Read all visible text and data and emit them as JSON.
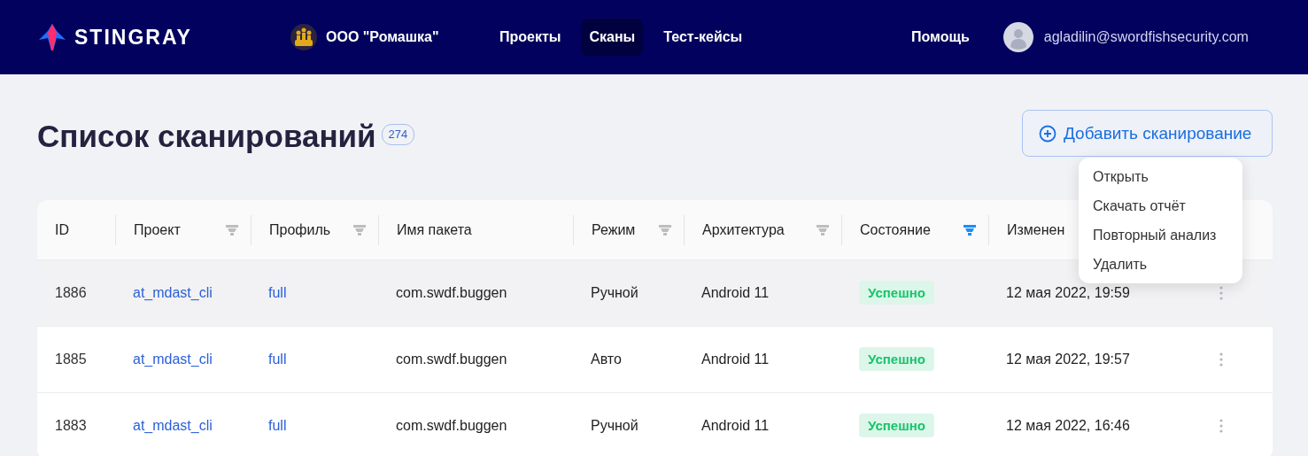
{
  "header": {
    "brand": "STINGRAY",
    "organization": "ООО \"Ромашка\"",
    "nav": [
      {
        "label": "Проекты",
        "selected": false
      },
      {
        "label": "Сканы",
        "selected": true
      },
      {
        "label": "Тест-кейсы",
        "selected": false
      }
    ],
    "help": "Помощь",
    "user_email": "agladilin@swordfishsecurity.com"
  },
  "page": {
    "title": "Список сканирований",
    "count": "274",
    "add_button": "Добавить сканирование"
  },
  "table": {
    "columns": [
      {
        "label": "ID"
      },
      {
        "label": "Проект",
        "filtered": false
      },
      {
        "label": "Профиль",
        "filtered": false
      },
      {
        "label": "Имя пакета"
      },
      {
        "label": "Режим",
        "filtered": false
      },
      {
        "label": "Архитектура",
        "filtered": false
      },
      {
        "label": "Состояние",
        "filtered": true
      },
      {
        "label": "Изменен"
      }
    ],
    "rows": [
      {
        "id": "1886",
        "project": "at_mdast_cli",
        "profile": "full",
        "package": "com.swdf.buggen",
        "mode": "Ручной",
        "arch": "Android 11",
        "status": "Успешно",
        "modified": "12 мая 2022, 19:59",
        "highlighted": true
      },
      {
        "id": "1885",
        "project": "at_mdast_cli",
        "profile": "full",
        "package": "com.swdf.buggen",
        "mode": "Авто",
        "arch": "Android 11",
        "status": "Успешно",
        "modified": "12 мая 2022, 19:57",
        "highlighted": false
      },
      {
        "id": "1883",
        "project": "at_mdast_cli",
        "profile": "full",
        "package": "com.swdf.buggen",
        "mode": "Ручной",
        "arch": "Android 11",
        "status": "Успешно",
        "modified": "12 мая 2022, 16:46",
        "highlighted": false
      }
    ]
  },
  "context_menu": {
    "items": [
      "Открыть",
      "Скачать отчёт",
      "Повторный анализ",
      "Удалить"
    ]
  }
}
